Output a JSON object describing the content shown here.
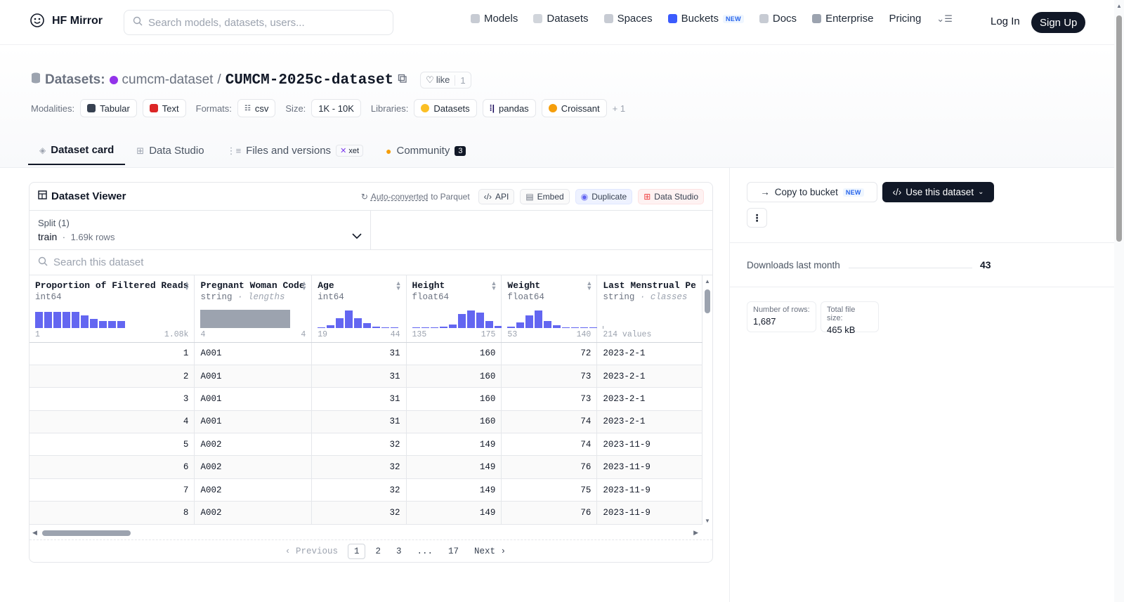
{
  "app": {
    "logo_text": "HF Mirror"
  },
  "search": {
    "placeholder": "Search models, datasets, users..."
  },
  "nav": {
    "links": [
      "Models",
      "Datasets",
      "Spaces",
      "Buckets",
      "Docs",
      "Enterprise",
      "Pricing"
    ],
    "buckets_badge": "NEW",
    "login": "Log In",
    "signup": "Sign Up"
  },
  "dataset": {
    "prefix": "Datasets:",
    "owner": "cumcm-dataset",
    "separator": "/",
    "name": "CUMCM-2025c-dataset",
    "like_label": "like",
    "like_count": "1"
  },
  "tags": {
    "modalities_label": "Modalities:",
    "modalities": [
      "Tabular",
      "Text"
    ],
    "formats_label": "Formats:",
    "formats": [
      "csv"
    ],
    "size_label": "Size:",
    "size": "1K - 10K",
    "libraries_label": "Libraries:",
    "libraries": [
      "Datasets",
      "pandas",
      "Croissant"
    ],
    "more": "+ 1"
  },
  "tabs": {
    "dataset_card": "Dataset card",
    "data_studio": "Data Studio",
    "files": "Files and versions",
    "files_badge": "xet",
    "community": "Community",
    "community_count": "3"
  },
  "viewer": {
    "title": "Dataset Viewer",
    "auto_converted": "Auto-converted",
    "to_parquet": "to Parquet",
    "api": "API",
    "embed": "Embed",
    "duplicate": "Duplicate",
    "data_studio": "Data Studio",
    "split_label": "Split (1)",
    "split_name": "train",
    "split_rows": "1.69k rows",
    "search_placeholder": "Search this dataset"
  },
  "columns": [
    {
      "name": "Proportion of Filtered Reads",
      "type": "int64",
      "subtype": "",
      "min": "1",
      "max": "1.08k",
      "hist": [
        0.9,
        0.9,
        0.9,
        0.9,
        0.9,
        0.7,
        0.5,
        0.4,
        0.4,
        0.4
      ],
      "hist_kind": "bars"
    },
    {
      "name": "Pregnant Woman Code",
      "type": "string",
      "subtype": "lengths",
      "min": "4",
      "max": "4",
      "hist": [
        1.0
      ],
      "hist_kind": "solid"
    },
    {
      "name": "Age",
      "type": "int64",
      "subtype": "",
      "min": "19",
      "max": "44",
      "hist": [
        0.05,
        0.15,
        0.55,
        0.95,
        0.55,
        0.25,
        0.08,
        0.05,
        0.02
      ],
      "hist_kind": "bars"
    },
    {
      "name": "Height",
      "type": "float64",
      "subtype": "",
      "min": "135",
      "max": "175",
      "hist": [
        0.02,
        0.0,
        0.04,
        0.08,
        0.2,
        0.75,
        0.95,
        0.85,
        0.4,
        0.1
      ],
      "hist_kind": "bars"
    },
    {
      "name": "Weight",
      "type": "float64",
      "subtype": "",
      "min": "53",
      "max": "140",
      "hist": [
        0.08,
        0.3,
        0.7,
        0.95,
        0.4,
        0.15,
        0.05,
        0.04,
        0.03,
        0.02
      ],
      "hist_kind": "bars"
    },
    {
      "name": "Last Menstrual Pe",
      "type": "string",
      "subtype": "classes",
      "min": "214 values",
      "max": "",
      "hist": [],
      "hist_kind": "classes"
    }
  ],
  "rows": [
    [
      "1",
      "A001",
      "31",
      "160",
      "72",
      "2023-2-1"
    ],
    [
      "2",
      "A001",
      "31",
      "160",
      "73",
      "2023-2-1"
    ],
    [
      "3",
      "A001",
      "31",
      "160",
      "73",
      "2023-2-1"
    ],
    [
      "4",
      "A001",
      "31",
      "160",
      "74",
      "2023-2-1"
    ],
    [
      "5",
      "A002",
      "32",
      "149",
      "74",
      "2023-11-9"
    ],
    [
      "6",
      "A002",
      "32",
      "149",
      "76",
      "2023-11-9"
    ],
    [
      "7",
      "A002",
      "32",
      "149",
      "75",
      "2023-11-9"
    ],
    [
      "8",
      "A002",
      "32",
      "149",
      "76",
      "2023-11-9"
    ]
  ],
  "pager": {
    "prev": "Previous",
    "pages": [
      "1",
      "2",
      "3",
      "...",
      "17"
    ],
    "next": "Next",
    "current": "1"
  },
  "sidebar": {
    "copy_bucket": "Copy to bucket",
    "copy_badge": "NEW",
    "use_dataset": "Use this dataset",
    "more": "⋮",
    "downloads_label": "Downloads last month",
    "downloads_value": "43",
    "rows_label": "Number of rows:",
    "rows_value": "1,687",
    "size_label": "Total file size:",
    "size_value": "465 kB"
  }
}
